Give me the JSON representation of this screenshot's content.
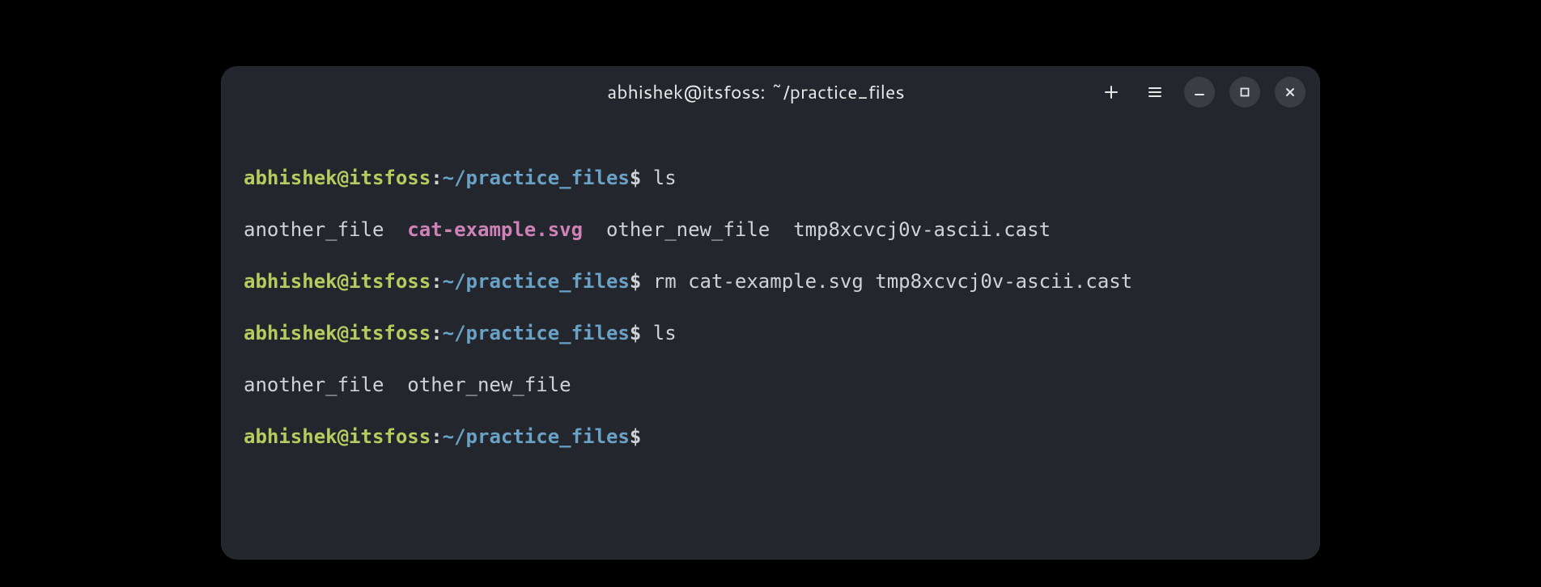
{
  "window": {
    "title": "abhishek@itsfoss: ~/practice_files"
  },
  "prompt": {
    "user": "abhishek",
    "at": "@",
    "host": "itsfoss",
    "colon": ":",
    "path": "~/practice_files",
    "dollar": "$"
  },
  "session": {
    "cmd1": " ls",
    "ls1": {
      "f1": "another_file  ",
      "f2": "cat-example.svg",
      "f3": "  other_new_file  tmp8xcvcj0v-ascii.cast"
    },
    "cmd2": " rm cat-example.svg tmp8xcvcj0v-ascii.cast",
    "cmd3": " ls",
    "ls2": "another_file  other_new_file",
    "cmd4": " "
  }
}
